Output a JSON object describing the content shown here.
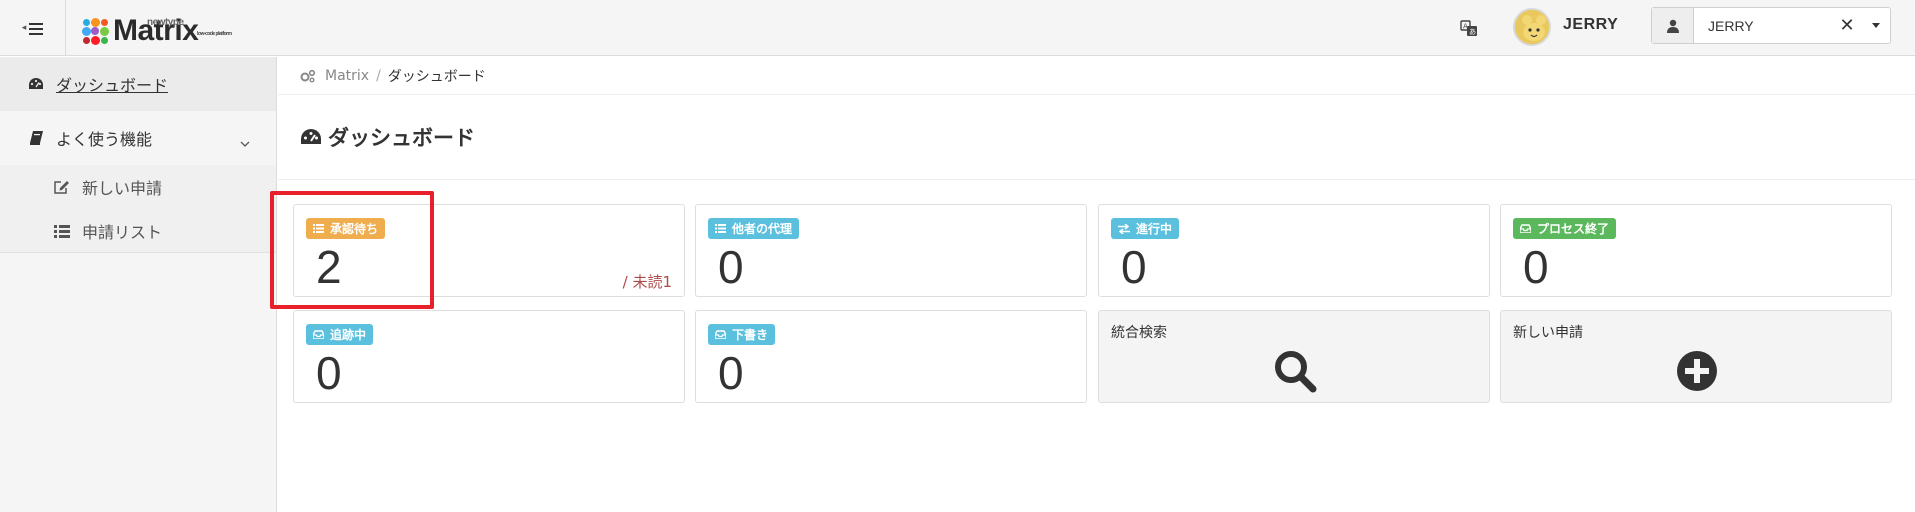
{
  "header": {
    "logo_small_top": "newtype",
    "logo_text": "Matrix",
    "logo_tagline": "low-code platform",
    "user_name": "JERRY",
    "user_select_value": "JERRY",
    "clear_glyph": "✕"
  },
  "sidebar": {
    "items": [
      {
        "label": "ダッシュボード",
        "icon": "dashboard-icon"
      },
      {
        "label": "よく使う機能",
        "icon": "book-icon"
      }
    ],
    "submenu": [
      {
        "label": "新しい申請",
        "icon": "edit-icon"
      },
      {
        "label": "申請リスト",
        "icon": "list-icon"
      }
    ]
  },
  "breadcrumb": {
    "root": "Matrix",
    "separator": "/",
    "current": "ダッシュボード"
  },
  "page": {
    "title": "ダッシュボード"
  },
  "cards": [
    {
      "label": "承認待ち",
      "value": "2",
      "extra": "/ 未読1",
      "color": "#f0ad4e",
      "icon": "list-icon"
    },
    {
      "label": "他者の代理",
      "value": "0",
      "color": "#5bc0de",
      "icon": "list-icon"
    },
    {
      "label": "進行中",
      "value": "0",
      "color": "#5bc0de",
      "icon": "exchange-icon"
    },
    {
      "label": "プロセス終了",
      "value": "0",
      "color": "#5cb85c",
      "icon": "inbox-icon"
    },
    {
      "label": "追跡中",
      "value": "0",
      "color": "#5bc0de",
      "icon": "inbox-icon"
    },
    {
      "label": "下書き",
      "value": "0",
      "color": "#5bc0de",
      "icon": "inbox-icon"
    }
  ],
  "actions": [
    {
      "label": "統合検索",
      "icon": "search-icon"
    },
    {
      "label": "新しい申請",
      "icon": "plus-circle-icon"
    }
  ],
  "colors": {
    "highlight": "#e8202a",
    "warning": "#f0ad4e",
    "info": "#5bc0de",
    "success": "#5cb85c"
  }
}
